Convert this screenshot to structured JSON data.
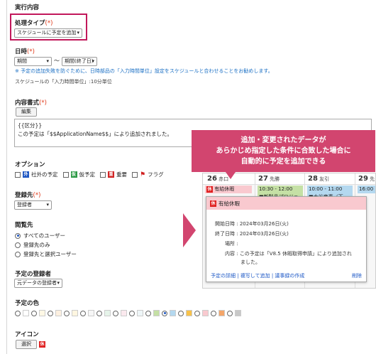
{
  "section_title": "実行内容",
  "process_type": {
    "label": "処理タイプ",
    "req": "(*)",
    "value": "スケジュールに予定を追加"
  },
  "datetime": {
    "label": "日時",
    "req": "(*)",
    "start": "期間",
    "tilde": "〜",
    "end": "期間(終了日)",
    "note": "※ 予定の追加失敗を防ぐために、日時部品の「入力時間単位」設定をスケジュールと合わせることをお勧めします。",
    "unit": "スケジュールの「入力時間単位」:10分単位"
  },
  "content_format": {
    "label": "内容書式",
    "req": "(*)",
    "edit_button": "編集",
    "line1": "{{区分}}",
    "line2": "この予定は「$$ApplicationName$$」により追加されました。"
  },
  "options": {
    "label": "オプション",
    "items": [
      {
        "badge": "外",
        "badge_color": "#1f57c3",
        "text": "社外の予定"
      },
      {
        "badge": "仮",
        "badge_color": "#2e9a46",
        "text": "仮予定"
      },
      {
        "badge": "重",
        "badge_color": "#d02020",
        "text": "重要"
      },
      {
        "badge": "",
        "badge_color": "#d02020",
        "text": "フラグ"
      }
    ]
  },
  "registrant": {
    "label": "登録先",
    "req": "(*)",
    "value": "登録者"
  },
  "viewers": {
    "label": "閲覧先",
    "items": [
      "すべてのユーザー",
      "登録先のみ",
      "登録先と選択ユーザー"
    ]
  },
  "registrar": {
    "label": "予定の登録者",
    "value": "元データの登録者"
  },
  "color": {
    "label": "予定の色",
    "swatches": [
      "#ffffff",
      "#fff8e5",
      "#fdf0e0",
      "#fff6e0",
      "#f6f6f6",
      "#e6f4ea",
      "#fbe9ee",
      "#eef6f8",
      "#c5e0a5",
      "#b4d8ef",
      "#f8c24a",
      "#f9c9cf",
      "#f4a66a",
      "#c8c8c8"
    ]
  },
  "icon": {
    "label": "アイコン",
    "button": "選択",
    "badge": "休"
  },
  "callout": {
    "line1": "追加・変更されたデータが",
    "line2": "あらかじめ指定した条件に合致した場合に",
    "line3": "自動的に予定を追加できる"
  },
  "calendar": {
    "days": [
      {
        "num": "26",
        "sub": "赤口"
      },
      {
        "num": "27",
        "sub": "先勝"
      },
      {
        "num": "28",
        "sub": "友引"
      },
      {
        "num": "29",
        "sub": "先"
      }
    ],
    "event_left": "有給休暇",
    "event_mid": "10:30 - 12:00",
    "event_mid2": "■新製品プロジェ",
    "event_right": "10:00 - 11:00",
    "event_right2": "■大谷商事（下",
    "event_far": "16:00"
  },
  "popup": {
    "title": "有給休暇",
    "start_label": "開始日時",
    "start": "2024年03月26日(火)",
    "end_label": "終了日時",
    "end": "2024年03月26日(火)",
    "place_label": "場所",
    "place": "",
    "content_label": "内容",
    "content1": "この予定は「V8.5 休暇取得申請」により追加され",
    "content2": "ました。",
    "links": [
      "予定の詳細",
      "複写して追加",
      "議事録の作成"
    ],
    "delete": "削除"
  }
}
